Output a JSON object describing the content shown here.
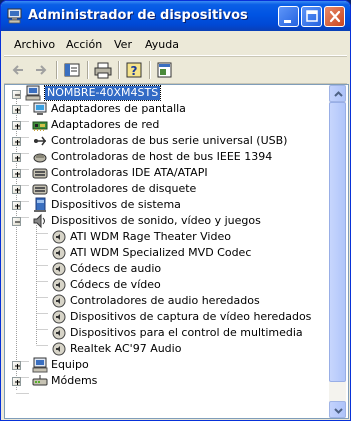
{
  "window": {
    "title": "Administrador de dispositivos",
    "buttons": {
      "minimize": "minimize-icon",
      "maximize": "maximize-icon",
      "close": "close-icon"
    }
  },
  "menu": [
    "Archivo",
    "Acción",
    "Ver",
    "Ayuda"
  ],
  "toolbar": [
    "back-arrow-icon",
    "forward-arrow-icon",
    "console-tree-icon",
    "print-icon",
    "help-icon",
    "properties-icon"
  ],
  "tree": {
    "root": "NOMBRE-40XM4STS",
    "categories": [
      "Adaptadores de pantalla",
      "Adaptadores de red",
      "Controladoras de bus serie universal (USB)",
      "Controladoras de host de bus IEEE 1394",
      "Controladoras IDE ATA/ATAPI",
      "Controladores de disquete",
      "Dispositivos de sistema",
      "Dispositivos de sonido, vídeo y juegos"
    ],
    "sound_children": [
      "ATI WDM Rage Theater Video",
      "ATI WDM Specialized MVD Codec",
      "Códecs de audio",
      "Códecs de vídeo",
      "Controladores de audio heredados",
      "Dispositivos de captura de vídeo heredados",
      "Dispositivos para el control de multimedia",
      "Realtek AC'97 Audio"
    ],
    "tail_categories": [
      "Equipo",
      "Módems"
    ]
  },
  "colors": {
    "selection": "#316ac5",
    "titlebar": "#0054e3",
    "window_bg": "#ece9d8"
  }
}
